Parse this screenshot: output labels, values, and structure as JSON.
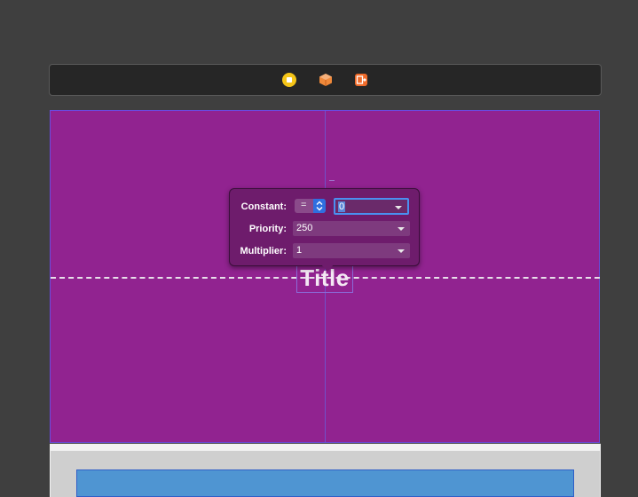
{
  "scene_bar": {
    "icons": [
      "view-controller-icon",
      "first-responder-icon",
      "exit-icon"
    ],
    "icon_colors": {
      "view_controller": "#f5c518",
      "first_responder": "#f0893a",
      "exit": "#f06b2a"
    }
  },
  "canvas": {
    "background": "#912390",
    "title_label": "Title"
  },
  "constraint_popover": {
    "constant_label": "Constant:",
    "relation": "=",
    "constant_value": "0",
    "priority_label": "Priority:",
    "priority_value": "250",
    "multiplier_label": "Multiplier:",
    "multiplier_value": "1"
  }
}
